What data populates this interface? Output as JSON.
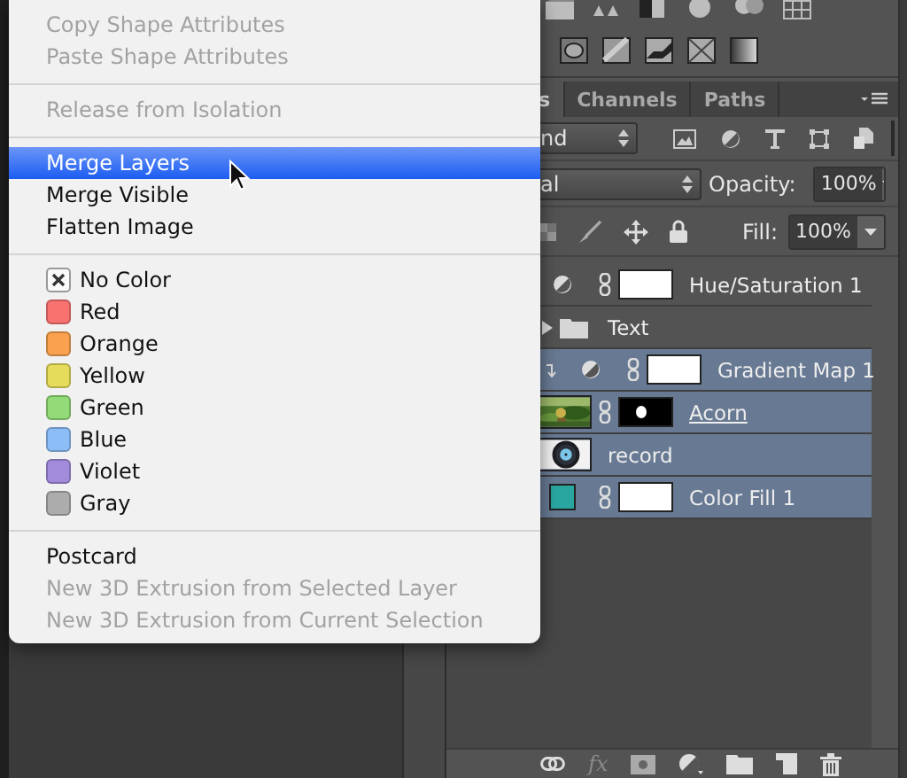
{
  "menu": {
    "items": [
      {
        "kind": "item",
        "label": "Copy Shape Attributes",
        "disabled": true,
        "selected": false
      },
      {
        "kind": "item",
        "label": "Paste Shape Attributes",
        "disabled": true,
        "selected": false
      },
      {
        "kind": "separator"
      },
      {
        "kind": "item",
        "label": "Release from Isolation",
        "disabled": true,
        "selected": false
      },
      {
        "kind": "separator"
      },
      {
        "kind": "item",
        "label": "Merge Layers",
        "disabled": false,
        "selected": true
      },
      {
        "kind": "item",
        "label": "Merge Visible",
        "disabled": false,
        "selected": false
      },
      {
        "kind": "item",
        "label": "Flatten Image",
        "disabled": false,
        "selected": false
      },
      {
        "kind": "separator"
      },
      {
        "kind": "no_color",
        "label": "No Color",
        "selected": false
      },
      {
        "kind": "color",
        "label": "Red",
        "color": "#f87370",
        "selected": false
      },
      {
        "kind": "color",
        "label": "Orange",
        "color": "#f9a14e",
        "selected": false
      },
      {
        "kind": "color",
        "label": "Yellow",
        "color": "#e5dc5b",
        "selected": false
      },
      {
        "kind": "color",
        "label": "Green",
        "color": "#92db78",
        "selected": false
      },
      {
        "kind": "color",
        "label": "Blue",
        "color": "#8dbdf7",
        "selected": false
      },
      {
        "kind": "color",
        "label": "Violet",
        "color": "#a38bdb",
        "selected": false
      },
      {
        "kind": "color",
        "label": "Gray",
        "color": "#acacac",
        "selected": false
      },
      {
        "kind": "separator"
      },
      {
        "kind": "item",
        "label": "Postcard",
        "disabled": false,
        "selected": false
      },
      {
        "kind": "item",
        "label": "New 3D Extrusion from Selected Layer",
        "disabled": true,
        "selected": false
      },
      {
        "kind": "item",
        "label": "New 3D Extrusion from Current Selection",
        "disabled": true,
        "selected": false
      }
    ]
  },
  "panel": {
    "tabs": [
      {
        "label": "s",
        "selected": true
      },
      {
        "label": "Channels",
        "selected": false
      },
      {
        "label": "Paths",
        "selected": false
      }
    ],
    "filter": {
      "value": "nd"
    },
    "blend": {
      "value": "al",
      "opacity_label": "Opacity:",
      "opacity": "100%"
    },
    "lock": {
      "fill_label": "Fill:",
      "fill": "100%"
    },
    "layers": [
      {
        "kind": "adjustment",
        "name": "Hue/Saturation 1",
        "selected": false,
        "clipped": false,
        "clip_base": false,
        "mask": true
      },
      {
        "kind": "group",
        "name": "Text",
        "selected": false,
        "clipped": false,
        "clip_base": false,
        "mask": false,
        "expanded": false
      },
      {
        "kind": "adjustment",
        "name": "Gradient Map 1",
        "selected": true,
        "clipped": true,
        "clip_base": false,
        "mask": true
      },
      {
        "kind": "pixel",
        "name": "Acorn",
        "selected": true,
        "clipped": false,
        "clip_base": true,
        "mask": true
      },
      {
        "kind": "pixel",
        "name": "record",
        "selected": true,
        "clipped": false,
        "clip_base": false,
        "mask": false
      },
      {
        "kind": "fill",
        "name": "Color Fill 1",
        "selected": true,
        "clipped": false,
        "clip_base": false,
        "mask": true
      }
    ],
    "footer": {
      "effects_label": "fx"
    }
  }
}
